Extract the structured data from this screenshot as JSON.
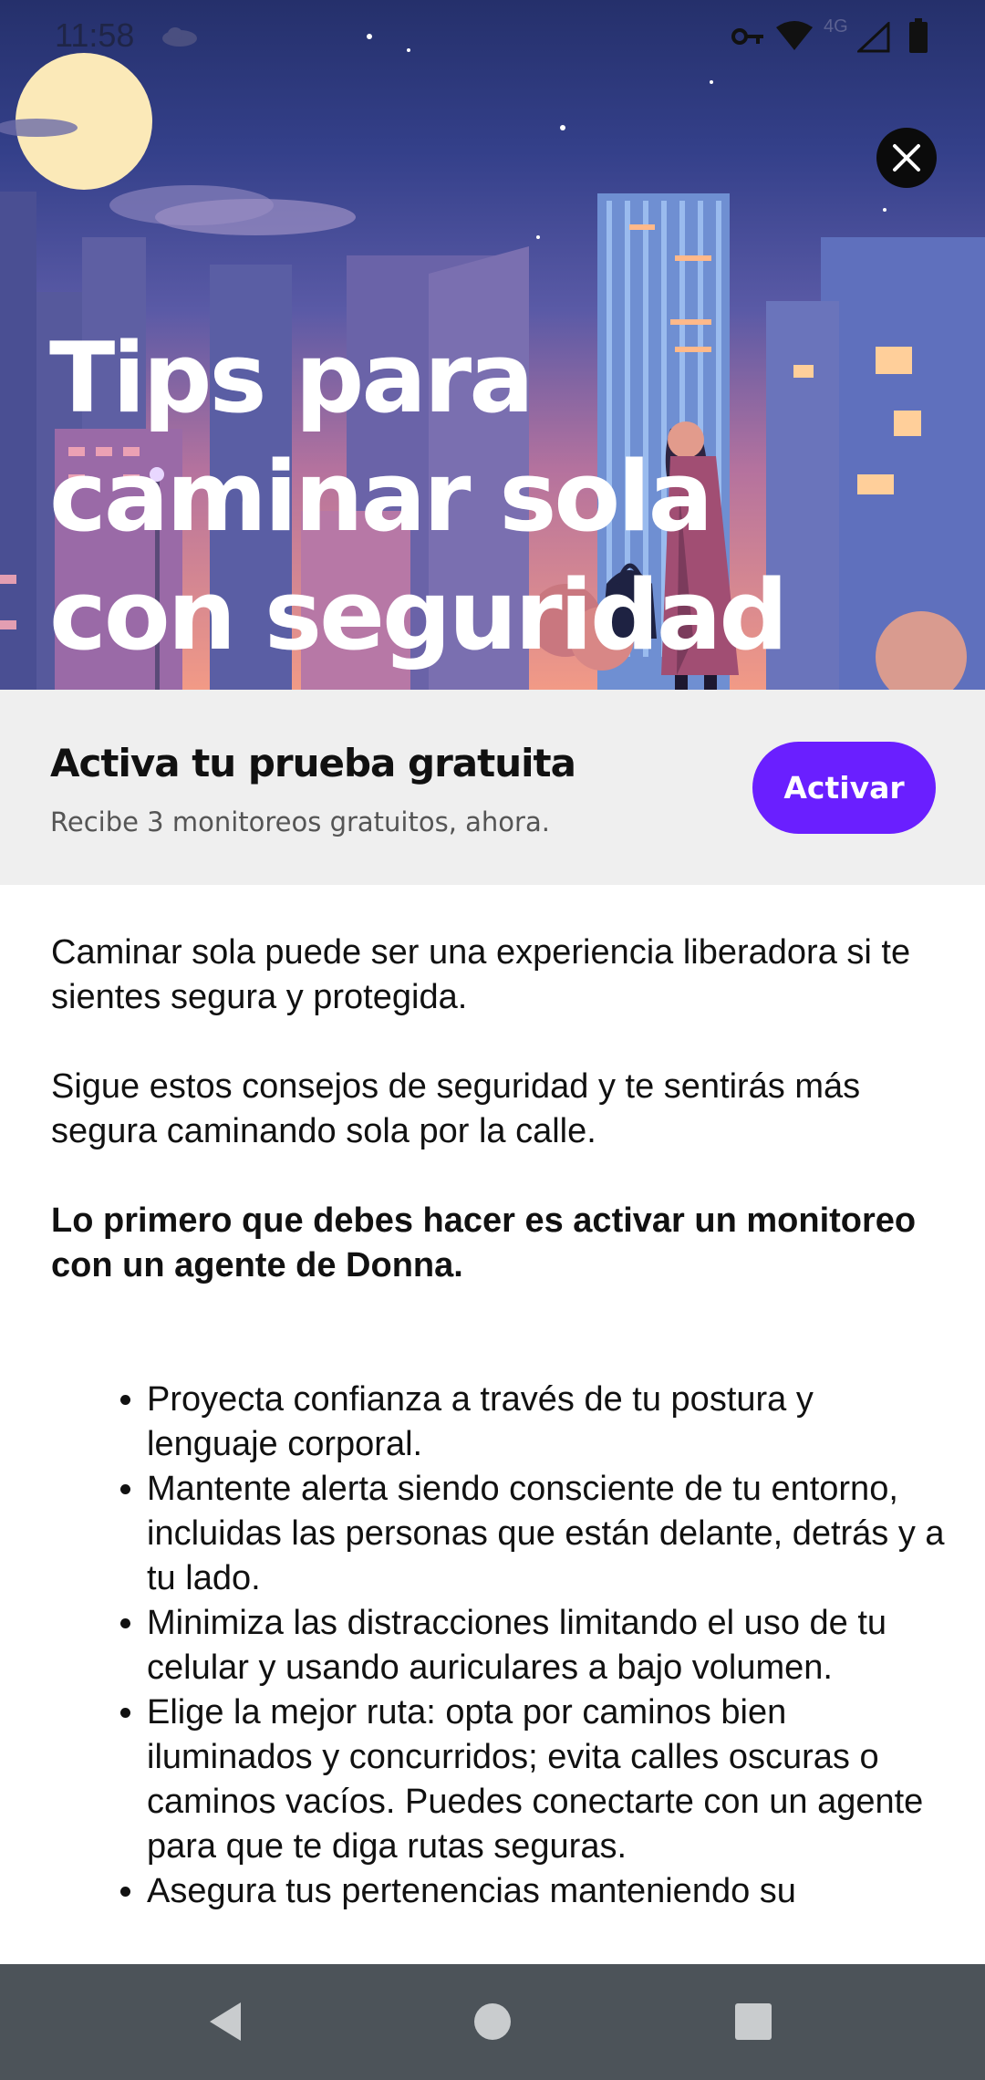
{
  "status_bar": {
    "time": "11:58",
    "icons": [
      "cloud-icon",
      "key-icon",
      "wifi-icon",
      "signal-4g-icon",
      "battery-icon"
    ],
    "network_label": "4G"
  },
  "hero": {
    "title": "Tips para caminar sola con seguridad",
    "close_icon": "close-icon"
  },
  "promo": {
    "title": "Activa tu prueba gratuita",
    "subtitle": "Recibe 3 monitoreos gratuitos, ahora.",
    "button_label": "Activar",
    "button_color": "#6a1fff"
  },
  "content": {
    "paragraphs": [
      "Caminar sola puede ser una experiencia liberadora si te sientes segura y protegida.",
      "Sigue estos consejos de seguridad y te sentirás más segura caminando sola por la calle."
    ],
    "highlight": "Lo primero que debes hacer es activar un monitoreo con un agente de Donna.",
    "bullets": [
      "Proyecta confianza a través de tu postura y lenguaje corporal.",
      "Mantente alerta siendo consciente de tu entorno, incluidas las personas que están delante, detrás y a tu lado.",
      "Minimiza las distracciones limitando el uso de tu celular y usando auriculares a bajo volumen.",
      "Elige la mejor ruta: opta por caminos bien iluminados y concurridos; evita calles oscuras o caminos vacíos. Puedes conectarte con un agente para que te diga rutas seguras.",
      "Asegura tus pertenencias manteniendo su"
    ]
  },
  "nav_bar": {
    "icons": [
      "back-icon",
      "home-icon",
      "recents-icon"
    ]
  }
}
